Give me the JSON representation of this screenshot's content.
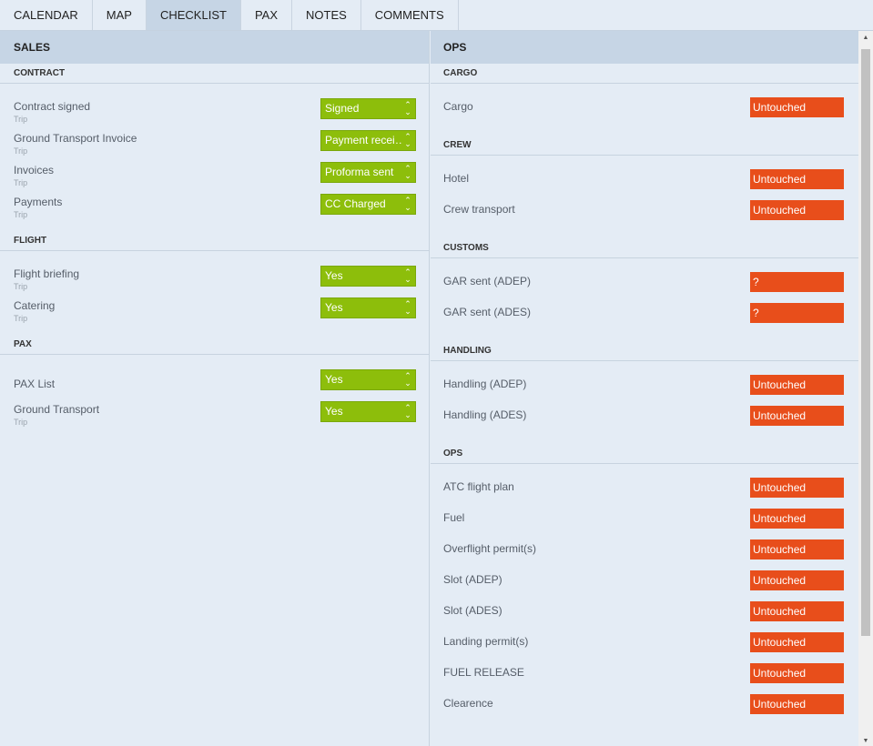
{
  "tabs": [
    "CALENDAR",
    "MAP",
    "CHECKLIST",
    "PAX",
    "NOTES",
    "COMMENTS"
  ],
  "active_tab": "CHECKLIST",
  "left": {
    "title": "SALES",
    "sections": [
      {
        "title": "CONTRACT",
        "items": [
          {
            "label": "Contract signed",
            "sub": "Trip",
            "value": "Signed"
          },
          {
            "label": "Ground Transport Invoice",
            "sub": "Trip",
            "value": "Payment recei…"
          },
          {
            "label": "Invoices",
            "sub": "Trip",
            "value": "Proforma sent"
          },
          {
            "label": "Payments",
            "sub": "Trip",
            "value": "CC Charged"
          }
        ]
      },
      {
        "title": "FLIGHT",
        "items": [
          {
            "label": "Flight briefing",
            "sub": "Trip",
            "value": "Yes"
          },
          {
            "label": "Catering",
            "sub": "Trip",
            "value": "Yes"
          }
        ]
      },
      {
        "title": "PAX",
        "items": [
          {
            "label": "PAX List",
            "sub": "",
            "value": "Yes"
          },
          {
            "label": "Ground Transport",
            "sub": "Trip",
            "value": "Yes"
          }
        ]
      }
    ]
  },
  "right": {
    "title": "OPS",
    "sections": [
      {
        "title": "CARGO",
        "items": [
          {
            "label": "Cargo",
            "value": "Untouched"
          }
        ]
      },
      {
        "title": "CREW",
        "items": [
          {
            "label": "Hotel",
            "value": "Untouched"
          },
          {
            "label": "Crew transport",
            "value": "Untouched"
          }
        ]
      },
      {
        "title": "CUSTOMS",
        "items": [
          {
            "label": "GAR sent (ADEP)",
            "value": "?"
          },
          {
            "label": "GAR sent (ADES)",
            "value": "?"
          }
        ]
      },
      {
        "title": "HANDLING",
        "items": [
          {
            "label": "Handling (ADEP)",
            "value": "Untouched"
          },
          {
            "label": "Handling (ADES)",
            "value": "Untouched"
          }
        ]
      },
      {
        "title": "OPS",
        "items": [
          {
            "label": "ATC flight plan",
            "value": "Untouched"
          },
          {
            "label": "Fuel",
            "value": "Untouched"
          },
          {
            "label": "Overflight permit(s)",
            "value": "Untouched"
          },
          {
            "label": "Slot (ADEP)",
            "value": "Untouched"
          },
          {
            "label": "Slot (ADES)",
            "value": "Untouched"
          },
          {
            "label": "Landing permit(s)",
            "value": "Untouched"
          },
          {
            "label": "FUEL RELEASE",
            "value": "Untouched"
          },
          {
            "label": "Clearence",
            "value": "Untouched"
          }
        ]
      }
    ]
  },
  "colors": {
    "ok": "#8dbe0b",
    "pending": "#e84e1b",
    "header": "#c6d5e5",
    "background": "#e4ecf5"
  },
  "icons": {
    "select": "chevron-up-down-icon",
    "scroll_up": "arrow-up-icon",
    "scroll_down": "arrow-down-icon"
  }
}
